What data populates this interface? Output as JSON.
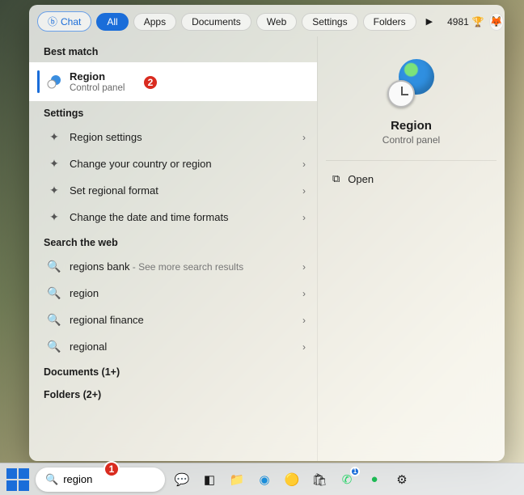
{
  "filters": {
    "chat": "Chat",
    "all": "All",
    "apps": "Apps",
    "documents": "Documents",
    "web": "Web",
    "settings": "Settings",
    "folders": "Folders"
  },
  "rewards_points": "4981",
  "sections": {
    "best_match": "Best match",
    "settings": "Settings",
    "web": "Search the web",
    "documents": "Documents (1+)",
    "folders": "Folders (2+)"
  },
  "best_match": {
    "title": "Region",
    "subtitle": "Control panel"
  },
  "settings_items": [
    {
      "label": "Region settings"
    },
    {
      "label": "Change your country or region"
    },
    {
      "label": "Set regional format"
    },
    {
      "label": "Change the date and time formats"
    }
  ],
  "web_items": [
    {
      "label": "regions bank",
      "secondary": " - See more search results"
    },
    {
      "label": "region",
      "secondary": ""
    },
    {
      "label": "regional finance",
      "secondary": ""
    },
    {
      "label": "regional",
      "secondary": ""
    }
  ],
  "preview": {
    "title": "Region",
    "subtitle": "Control panel",
    "open": "Open"
  },
  "search": {
    "value": "region",
    "placeholder": "Search"
  },
  "callouts": {
    "one": "1",
    "two": "2"
  }
}
